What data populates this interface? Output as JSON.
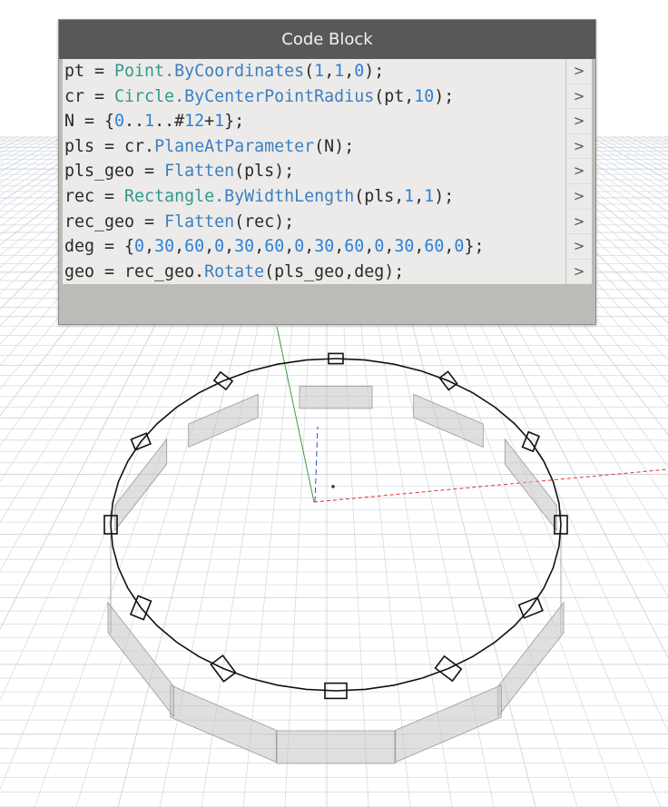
{
  "node": {
    "title": "Code Block",
    "lines": [
      [
        {
          "t": "pt = ",
          "k": "plain"
        },
        {
          "t": "Point",
          "k": "class"
        },
        {
          "t": ".ByCoordinates",
          "k": "method"
        },
        {
          "t": "(",
          "k": "plain"
        },
        {
          "t": "1",
          "k": "num"
        },
        {
          "t": ",",
          "k": "plain"
        },
        {
          "t": "1",
          "k": "num"
        },
        {
          "t": ",",
          "k": "plain"
        },
        {
          "t": "0",
          "k": "num"
        },
        {
          "t": ");",
          "k": "plain"
        }
      ],
      [
        {
          "t": "cr = ",
          "k": "plain"
        },
        {
          "t": "Circle",
          "k": "class"
        },
        {
          "t": ".ByCenterPointRadius",
          "k": "method"
        },
        {
          "t": "(pt,",
          "k": "plain"
        },
        {
          "t": "10",
          "k": "num"
        },
        {
          "t": ");",
          "k": "plain"
        }
      ],
      [
        {
          "t": "N = {",
          "k": "plain"
        },
        {
          "t": "0",
          "k": "num"
        },
        {
          "t": "..",
          "k": "plain"
        },
        {
          "t": "1",
          "k": "num"
        },
        {
          "t": "..#",
          "k": "plain"
        },
        {
          "t": "12",
          "k": "num"
        },
        {
          "t": "+",
          "k": "plain"
        },
        {
          "t": "1",
          "k": "num"
        },
        {
          "t": "};",
          "k": "plain"
        }
      ],
      [
        {
          "t": "pls = cr.",
          "k": "plain"
        },
        {
          "t": "PlaneAtParameter",
          "k": "method"
        },
        {
          "t": "(N);",
          "k": "plain"
        }
      ],
      [
        {
          "t": "pls_geo = ",
          "k": "plain"
        },
        {
          "t": "Flatten",
          "k": "method"
        },
        {
          "t": "(pls);",
          "k": "plain"
        }
      ],
      [
        {
          "t": "rec = ",
          "k": "plain"
        },
        {
          "t": "Rectangle",
          "k": "class"
        },
        {
          "t": ".ByWidthLength",
          "k": "method"
        },
        {
          "t": "(pls,",
          "k": "plain"
        },
        {
          "t": "1",
          "k": "num"
        },
        {
          "t": ",",
          "k": "plain"
        },
        {
          "t": "1",
          "k": "num"
        },
        {
          "t": ");",
          "k": "plain"
        }
      ],
      [
        {
          "t": "rec_geo = ",
          "k": "plain"
        },
        {
          "t": "Flatten",
          "k": "method"
        },
        {
          "t": "(rec);",
          "k": "plain"
        }
      ],
      [
        {
          "t": "deg = {",
          "k": "plain"
        },
        {
          "t": "0",
          "k": "num"
        },
        {
          "t": ",",
          "k": "plain"
        },
        {
          "t": "30",
          "k": "num"
        },
        {
          "t": ",",
          "k": "plain"
        },
        {
          "t": "60",
          "k": "num"
        },
        {
          "t": ",",
          "k": "plain"
        },
        {
          "t": "0",
          "k": "num"
        },
        {
          "t": ",",
          "k": "plain"
        },
        {
          "t": "30",
          "k": "num"
        },
        {
          "t": ",",
          "k": "plain"
        },
        {
          "t": "60",
          "k": "num"
        },
        {
          "t": ",",
          "k": "plain"
        },
        {
          "t": "0",
          "k": "num"
        },
        {
          "t": ",",
          "k": "plain"
        },
        {
          "t": "30",
          "k": "num"
        },
        {
          "t": ",",
          "k": "plain"
        },
        {
          "t": "60",
          "k": "num"
        },
        {
          "t": ",",
          "k": "plain"
        },
        {
          "t": "0",
          "k": "num"
        },
        {
          "t": ",",
          "k": "plain"
        },
        {
          "t": "30",
          "k": "num"
        },
        {
          "t": ",",
          "k": "plain"
        },
        {
          "t": "60",
          "k": "num"
        },
        {
          "t": ",",
          "k": "plain"
        },
        {
          "t": "0",
          "k": "num"
        },
        {
          "t": "};",
          "k": "plain"
        }
      ],
      [
        {
          "t": "geo = rec_geo.",
          "k": "plain"
        },
        {
          "t": "Rotate",
          "k": "method"
        },
        {
          "t": "(pls_geo,deg);",
          "k": "plain"
        }
      ]
    ],
    "output_port_label": ">",
    "output_port_count": 9
  },
  "colors": {
    "background": "#ffffff",
    "grid_minor": "#d6dde4",
    "grid_major": "#c6cfd8",
    "node_header": "#5a5856",
    "node_body": "#ecebe9",
    "node_frame": "#bdbbb8",
    "token_class": "#2f9a8c",
    "token_method": "#3d7fc1",
    "token_number": "#2f7fd6",
    "plane_fill": "rgba(196,196,196,0.55)",
    "plane_edge": "#9a9a9a",
    "curve": "#111111",
    "axis_x": "#e0312d",
    "axis_y": "#3aa03a",
    "axis_z": "#2d4fd0"
  },
  "scene": {
    "circle_radius": 10,
    "plane_count": 13,
    "rotation_degrees": [
      0,
      30,
      60,
      0,
      30,
      60,
      0,
      30,
      60,
      0,
      30,
      60,
      0
    ]
  }
}
